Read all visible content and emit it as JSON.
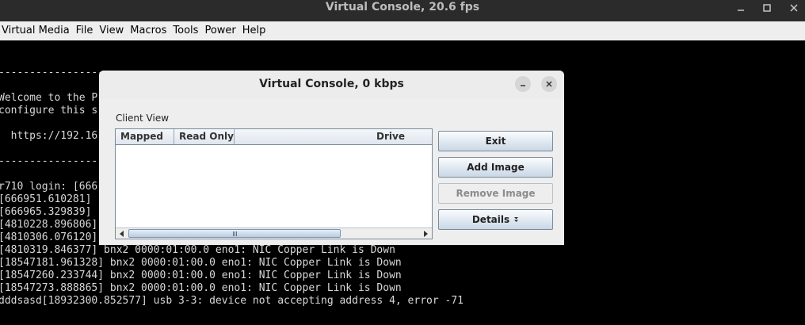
{
  "window": {
    "title": "Virtual Console, 20.6 fps",
    "controls": {
      "minimize": "minimize-icon",
      "maximize": "maximize-icon",
      "close": "close-icon"
    }
  },
  "menubar": {
    "items": [
      "Virtual Media",
      "File",
      "View",
      "Macros",
      "Tools",
      "Power",
      "Help"
    ]
  },
  "console": {
    "lines": [
      "--------------------------------------------------------------------------------",
      "Welcome to the P",
      "configure this s",
      "",
      "  https://192.16",
      "",
      "--------------------------------------------------------------------------------",
      "",
      "r710 login: [666",
      "[666951.610281]",
      "[666965.329839]",
      "[4810228.896806]",
      "[4810306.076120]",
      "[4810319.846377] bnx2 0000:01:00.0 eno1: NIC Copper Link is Down",
      "[18547181.961328] bnx2 0000:01:00.0 eno1: NIC Copper Link is Down",
      "[18547260.233744] bnx2 0000:01:00.0 eno1: NIC Copper Link is Down",
      "[18547273.888865] bnx2 0000:01:00.0 eno1: NIC Copper Link is Down",
      "dddsasd[18932300.852577] usb 3-3: device not accepting address 4, error -71"
    ]
  },
  "dialog": {
    "title": "Virtual Console, 0 kbps",
    "client_view_label": "Client View",
    "table": {
      "columns": [
        "Mapped",
        "Read Only",
        "Drive"
      ],
      "rows": []
    },
    "buttons": {
      "exit": "Exit",
      "add_image": "Add Image",
      "remove_image": "Remove Image",
      "details": "Details"
    }
  },
  "colors": {
    "titlebar": "#2b2b2b",
    "menubar": "#eeeeee",
    "console_bg": "#000000",
    "console_text": "#d8d8d8",
    "button_border": "#7a8a99"
  }
}
